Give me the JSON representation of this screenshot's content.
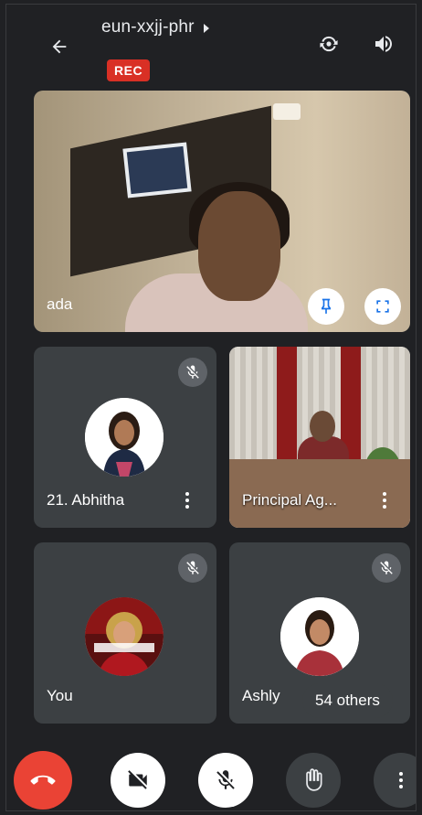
{
  "header": {
    "title": "eun-xxjj-phr",
    "rec_label": "REC"
  },
  "tiles": {
    "main": {
      "name": "ada"
    },
    "abhitha": {
      "name": "21. Abhitha"
    },
    "principal": {
      "name": "Principal Ag..."
    },
    "you": {
      "name": "You"
    },
    "ashly": {
      "name": "Ashly"
    }
  },
  "others": {
    "label": "54 others"
  },
  "colors": {
    "background": "#202124",
    "tile": "#3c4043",
    "rec": "#d93025",
    "end_call": "#ea4335",
    "pin_accent": "#1a73e8"
  },
  "icons": {
    "back": "arrow-left-icon",
    "title_caret": "caret-right-icon",
    "switch_camera": "switch-camera-icon",
    "speaker": "speaker-icon",
    "pin": "pin-icon",
    "fullscreen": "fullscreen-icon",
    "mic_off": "mic-off-icon",
    "more": "more-vert-icon",
    "end_call": "end-call-icon",
    "camera_off": "camera-off-icon",
    "raise_hand": "raise-hand-icon"
  }
}
